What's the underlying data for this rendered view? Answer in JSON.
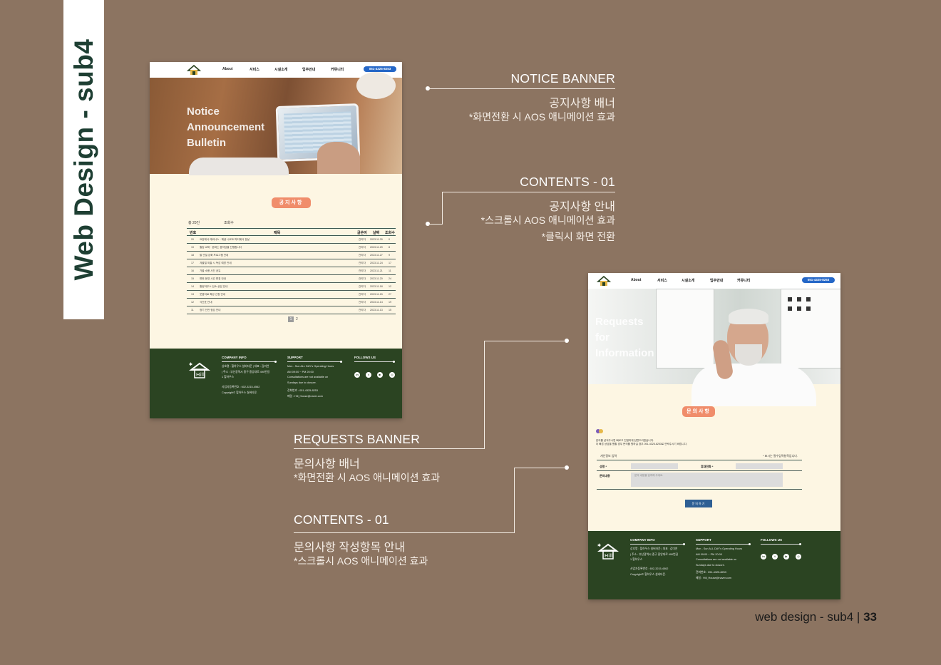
{
  "page_title": "Web Design - sub4",
  "page_footer": {
    "label": "web design - sub4",
    "separator": "|",
    "page_number": "33"
  },
  "nav": {
    "items": [
      "About",
      "서비스",
      "시설소개",
      "입주안내",
      "커뮤니티"
    ],
    "phone": "051-4325-8253"
  },
  "notice_mock": {
    "banner_title": "Notice\nAnnouncement\nBulletin",
    "section_chip": "공지사항",
    "total": "총 20건",
    "sort": "조회수",
    "table_headers": [
      "번호",
      "제목",
      "글쓴이",
      "날짜",
      "조회수"
    ],
    "rows": [
      {
        "no": "20",
        "title": "요양레서 레비나스 · 해골 니르트 파티에서 장날",
        "author": "관리자",
        "date": "2023.11.30",
        "views": "0"
      },
      {
        "no": "19",
        "title": "힐링 교육 · 완화는 음악당을 진행합니다",
        "author": "관리자",
        "date": "2023.11.29",
        "views": "8"
      },
      {
        "no": "18",
        "title": "팔 관절 강화 프로그램 안내",
        "author": "관리자",
        "date": "2023.11.27",
        "views": "9"
      },
      {
        "no": "17",
        "title": "겨울철 외출 시 독감 예방 안내",
        "author": "관리자",
        "date": "2023.11.24",
        "views": "17"
      },
      {
        "no": "16",
        "title": "가을 소풍 사진 공유",
        "author": "관리자",
        "date": "2023.11.21",
        "views": "11"
      },
      {
        "no": "15",
        "title": "면회 운영 시간 변경 안내",
        "author": "관리자",
        "date": "2023.11.20",
        "views": "24"
      },
      {
        "no": "14",
        "title": "힐링하우스 입소 상담 안내",
        "author": "관리자",
        "date": "2023.11.18",
        "views": "12"
      },
      {
        "no": "13",
        "title": "웃음치료 특강 신청 안내",
        "author": "관리자",
        "date": "2023.11.15",
        "views": "27"
      },
      {
        "no": "12",
        "title": "식단표 안내",
        "author": "관리자",
        "date": "2023.11.14",
        "views": "19"
      },
      {
        "no": "11",
        "title": "정기 안전 점검 안내",
        "author": "관리자",
        "date": "2023.11.13",
        "views": "15"
      }
    ],
    "pages": [
      "1",
      "2"
    ]
  },
  "request_mock": {
    "banner_title": "Requests\nfor\nInformation",
    "section_chip": "문의사항",
    "intro": "문의를 남겨주시면 빠르고 친절하게 답변드리겠습니다.\n더 빠른 상담을 원할 경우 문의를 원하실 경우 051-4325-8253로 연락주시기 바랍니다.",
    "personal_info_label": "개인정보 입력",
    "required_note": "* 표시는 필수입력항목입니다.",
    "name_label": "성명 *",
    "phone_label": "휴대전화 *",
    "content_label": "문의내용",
    "content_placeholder": "문의 내용을 입력해 주세요.",
    "submit_label": "문의하기"
  },
  "footer": {
    "company_title": "COMPANY INFO",
    "company_text": "상호명 : 힐하우스 실버타운 | 대표 : 김미연\n| 주소 : 부산광역시 중구 중앙대로 490번길\n1 힐하우스",
    "company_text2": "사업자등록번호 : 602-3215-4562\nCopyright© 힐하우스 실버타운.",
    "support_title": "SUPPORT",
    "support_text": "Mon - Sun ALL DAY's  Operating Hours\nAM 09:00 ~ PM 20:00\nConsultations are not available on\nSundays due to closure.",
    "support_text2": "전화번호 : 051-4325-8253\n메일 : Hill_House@naver.com",
    "follow_title": "FOLLOWS US",
    "social_icons": [
      "in",
      "t",
      "▶",
      "◎"
    ]
  },
  "annotations": {
    "notice_banner": {
      "title": "NOTICE BANNER",
      "sub1": "공지사항 배너",
      "sub2": "*화면전환 시 AOS 애니메이션 효과"
    },
    "contents_notice": {
      "title": "CONTENTS - 01",
      "sub1": "공지사항 안내",
      "sub2": "*스크롤시 AOS 애니메이션 효과",
      "sub3": "*클릭시 화면 전환"
    },
    "requests_banner": {
      "title": "REQUESTS BANNER",
      "sub1": "문의사항 배너",
      "sub2": "*화면전환 시 AOS 애니메이션 효과"
    },
    "contents_request": {
      "title": "CONTENTS - 01",
      "sub1": "문의사항 작성항목 안내",
      "sub2": "*스크롤시 AOS 애니메이션 효과"
    }
  },
  "colors": {
    "background": "#8c7461",
    "footer_green": "#2b4422",
    "cream": "#fdf6e3",
    "accent_orange": "#f08d6b",
    "title_green": "#1e3f33",
    "phone_blue": "#2567c7"
  }
}
